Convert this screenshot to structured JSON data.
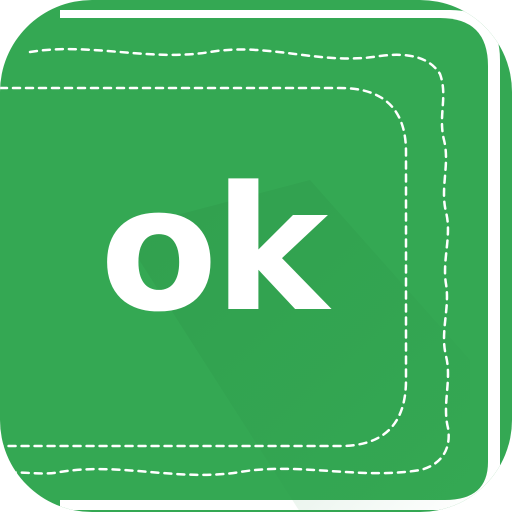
{
  "app_icon": {
    "name": "ok",
    "text": "ok",
    "colors": {
      "background": "#34a853",
      "edge_green": "#2e9c4b",
      "page_stack": "#ffffff",
      "stitch": "#ffffff",
      "shadow": "#2b8f45"
    }
  }
}
